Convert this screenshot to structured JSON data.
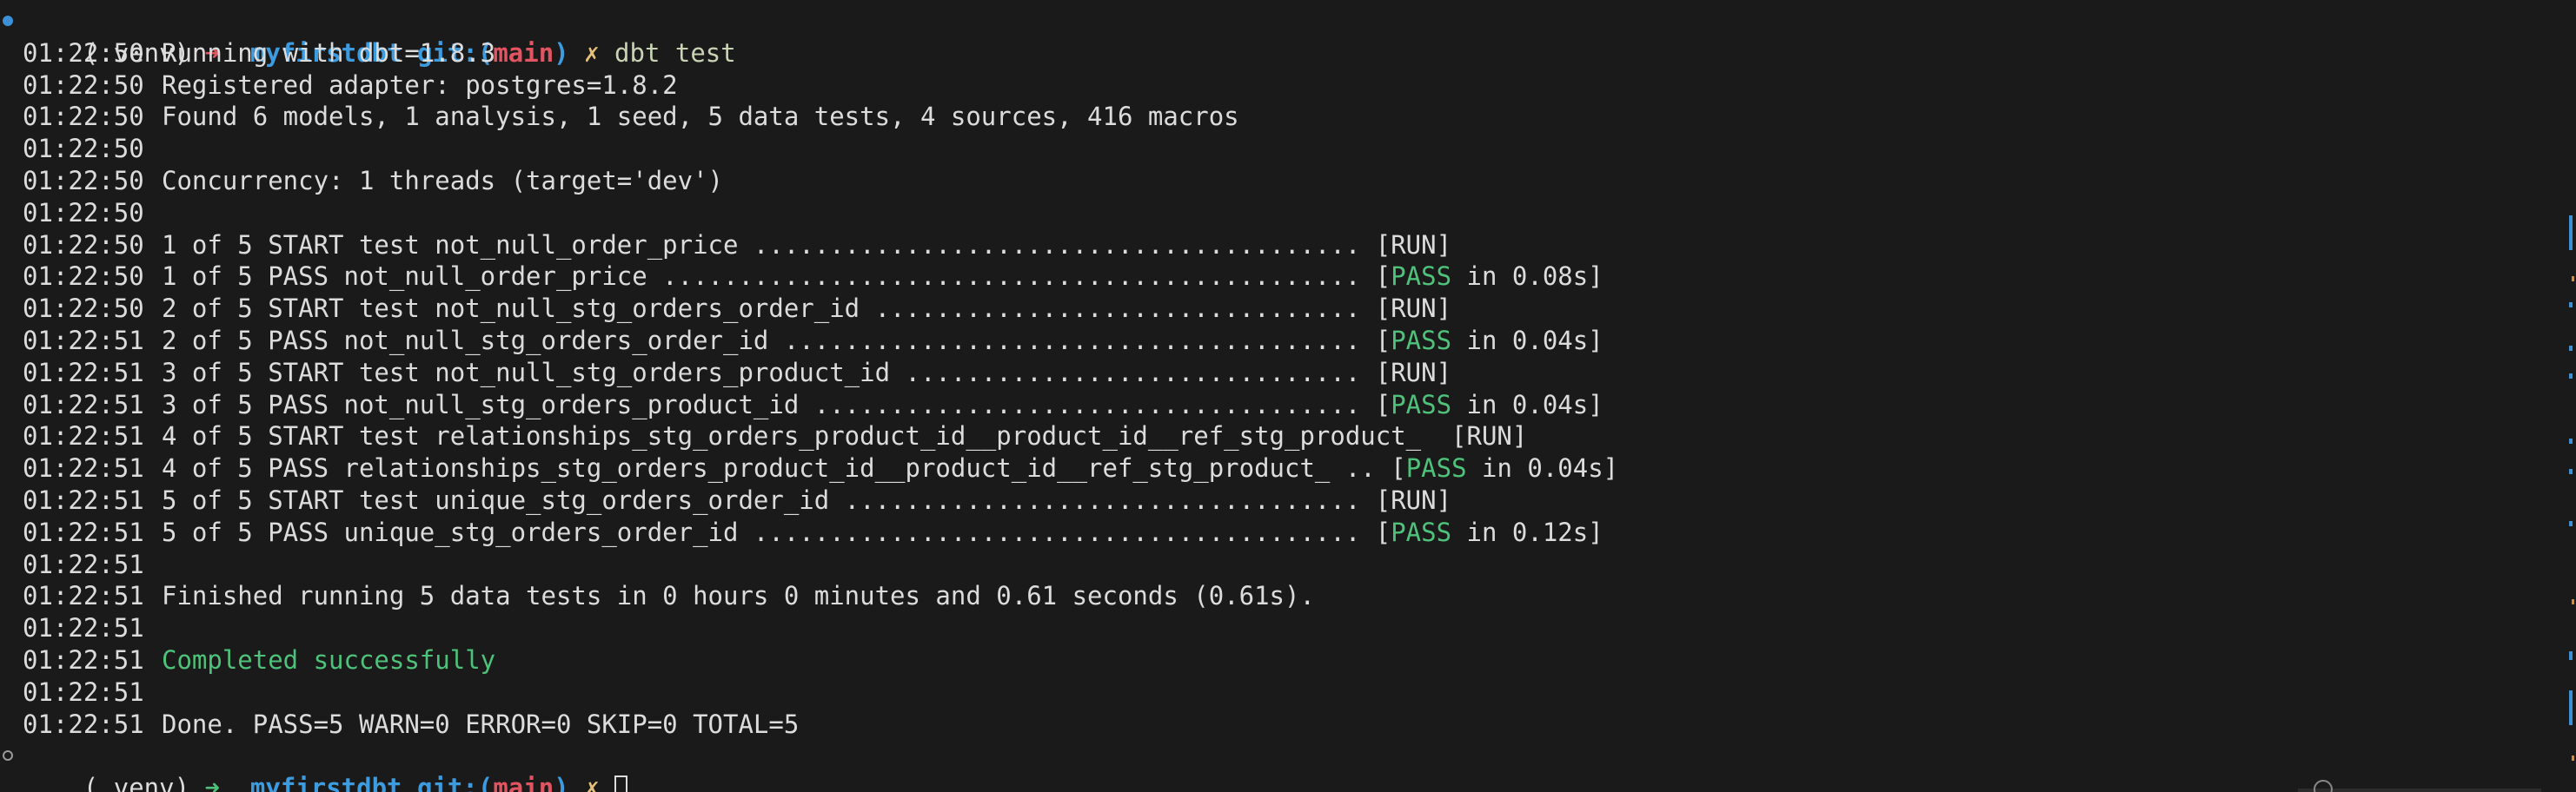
{
  "prompt": {
    "venv": "(.venv)",
    "arrow": "➜",
    "dir": "myfirstdbt",
    "git_label": "git:(",
    "branch": "main",
    "git_close": ")",
    "dirty": "✗",
    "command": "dbt test"
  },
  "output": [
    {
      "ts": "01:22:50",
      "text": "Running with dbt=1.8.3"
    },
    {
      "ts": "01:22:50",
      "text": "Registered adapter: postgres=1.8.2"
    },
    {
      "ts": "01:22:50",
      "text": "Found 6 models, 1 analysis, 1 seed, 5 data tests, 4 sources, 416 macros"
    },
    {
      "ts": "01:22:50",
      "text": ""
    },
    {
      "ts": "01:22:50",
      "text": "Concurrency: 1 threads (target='dev')"
    },
    {
      "ts": "01:22:50",
      "text": ""
    },
    {
      "ts": "01:22:50",
      "text": "1 of 5 START test not_null_order_price ........................................ [RUN]"
    },
    {
      "ts": "01:22:50",
      "text": "1 of 5 PASS not_null_order_price .............................................. [",
      "pass": "PASS",
      "tail": " in 0.08s]"
    },
    {
      "ts": "01:22:50",
      "text": "2 of 5 START test not_null_stg_orders_order_id ................................ [RUN]"
    },
    {
      "ts": "01:22:51",
      "text": "2 of 5 PASS not_null_stg_orders_order_id ...................................... [",
      "pass": "PASS",
      "tail": " in 0.04s]"
    },
    {
      "ts": "01:22:51",
      "text": "3 of 5 START test not_null_stg_orders_product_id .............................. [RUN]"
    },
    {
      "ts": "01:22:51",
      "text": "3 of 5 PASS not_null_stg_orders_product_id .................................... [",
      "pass": "PASS",
      "tail": " in 0.04s]"
    },
    {
      "ts": "01:22:51",
      "text": "4 of 5 START test relationships_stg_orders_product_id__product_id__ref_stg_product_  [RUN]"
    },
    {
      "ts": "01:22:51",
      "text": "4 of 5 PASS relationships_stg_orders_product_id__product_id__ref_stg_product_ .. [",
      "pass": "PASS",
      "tail": " in 0.04s]"
    },
    {
      "ts": "01:22:51",
      "text": "5 of 5 START test unique_stg_orders_order_id .................................. [RUN]"
    },
    {
      "ts": "01:22:51",
      "text": "5 of 5 PASS unique_stg_orders_order_id ........................................ [",
      "pass": "PASS",
      "tail": " in 0.12s]"
    },
    {
      "ts": "01:22:51",
      "text": ""
    },
    {
      "ts": "01:22:51",
      "text": "Finished running 5 data tests in 0 hours 0 minutes and 0.61 seconds (0.61s)."
    },
    {
      "ts": "01:22:51",
      "text": ""
    },
    {
      "ts": "01:22:51",
      "text": "",
      "success": "Completed successfully"
    },
    {
      "ts": "01:22:51",
      "text": ""
    },
    {
      "ts": "01:22:51",
      "text": "Done. PASS=5 WARN=0 ERROR=0 SKIP=0 TOTAL=5"
    }
  ],
  "colors": {
    "background": "#1a1a1a",
    "text": "#dcdcdc",
    "success": "#4ec27a",
    "dir": "#3d9be0",
    "branch": "#e05561",
    "dirty": "#e5c07b",
    "prompt_arrow_error": "#e05561",
    "prompt_arrow_ok": "#4ec27a"
  }
}
